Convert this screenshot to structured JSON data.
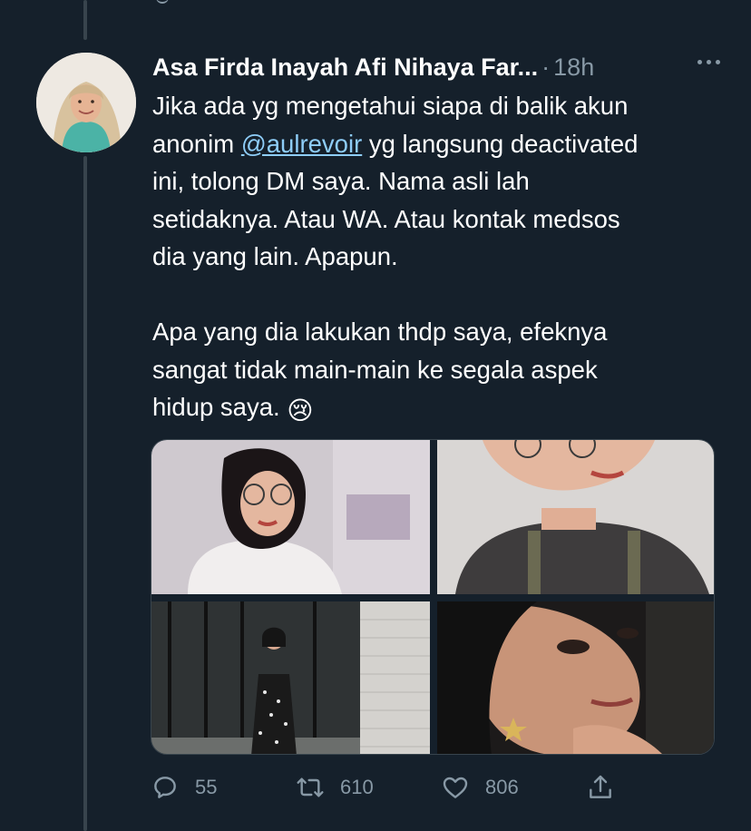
{
  "tweet": {
    "author_name": "Asa Firda Inayah Afi Nihaya Far...",
    "separator": "·",
    "time": "18h",
    "text_lines": {
      "l1": "Jika ada yg mengetahui siapa di balik akun",
      "l2_pre": "anonim ",
      "l2_mention": "@aulrevoir",
      "l2_post": " yg langsung deactivated",
      "l3": "ini, tolong DM saya. Nama asli lah",
      "l4": "setidaknya. Atau WA. Atau kontak medsos",
      "l5": "dia yang lain. Apapun.",
      "l6": "Apa yang dia lakukan thdp saya, efeknya",
      "l7": "sangat tidak main-main ke segala aspek",
      "l8": "hidup saya. ",
      "emoji": "😢"
    },
    "media": [
      {
        "alt": "photo-1"
      },
      {
        "alt": "photo-2"
      },
      {
        "alt": "photo-3"
      },
      {
        "alt": "photo-4"
      }
    ],
    "actions": {
      "reply_count": "55",
      "retweet_count": "610",
      "like_count": "806"
    }
  },
  "icons": {
    "reply": "reply-icon",
    "retweet": "retweet-icon",
    "like": "heart-icon",
    "share": "share-icon",
    "more": "more-icon"
  },
  "colors": {
    "background": "#15202b",
    "secondary_text": "#8899a6",
    "mention": "#8ecdf8",
    "thread_line": "#38444d"
  }
}
